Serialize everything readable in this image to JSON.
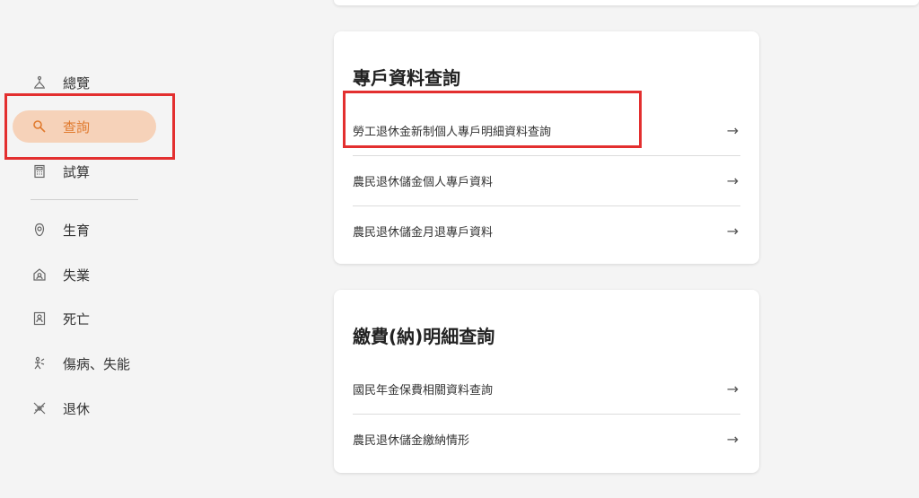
{
  "sidebar": {
    "items": [
      {
        "label": "總覽",
        "icon": "overview-icon"
      },
      {
        "label": "查詢",
        "icon": "search-icon"
      },
      {
        "label": "試算",
        "icon": "calculator-icon"
      },
      {
        "label": "生育",
        "icon": "birth-icon"
      },
      {
        "label": "失業",
        "icon": "unemployment-icon"
      },
      {
        "label": "死亡",
        "icon": "death-icon"
      },
      {
        "label": "傷病、失能",
        "icon": "injury-icon"
      },
      {
        "label": "退休",
        "icon": "retirement-icon"
      }
    ]
  },
  "cards": [
    {
      "title": "專戶資料查詢",
      "rows": [
        {
          "label": "勞工退休金新制個人專戶明細資料查詢"
        },
        {
          "label": "農民退休儲金個人專戶資料"
        },
        {
          "label": "農民退休儲金月退專戶資料"
        }
      ]
    },
    {
      "title": "繳費(納)明細查詢",
      "rows": [
        {
          "label": "國民年金保費相關資料查詢"
        },
        {
          "label": "農民退休儲金繳納情形"
        }
      ]
    }
  ],
  "colors": {
    "accent": "#e07a2e",
    "active_bg": "#f6d2b9",
    "highlight": "#e32f2f"
  }
}
